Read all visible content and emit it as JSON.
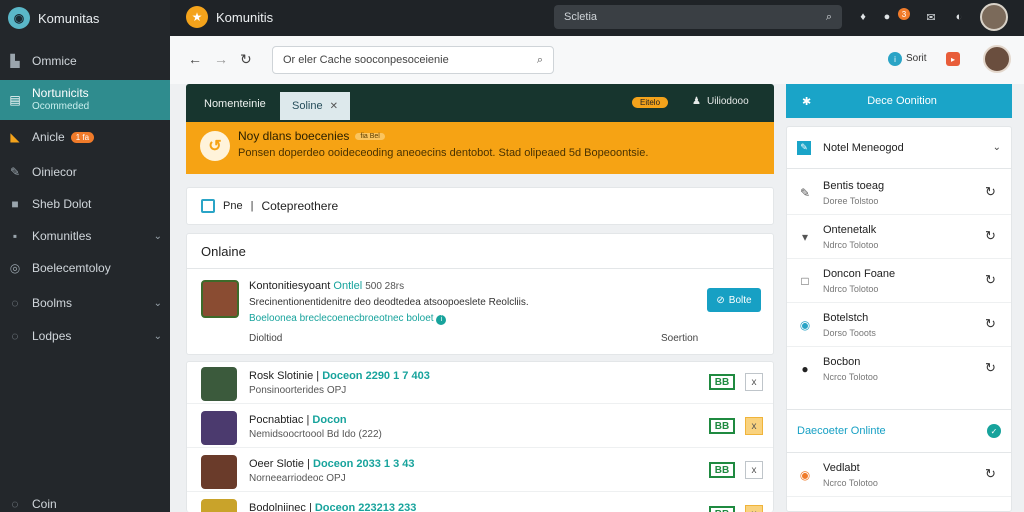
{
  "app": {
    "title": "Komunitas"
  },
  "sidebar": {
    "items": [
      {
        "label": "Ommice",
        "icon": "home-icon"
      },
      {
        "label": "Nortunicits",
        "sub": "Ocommeded",
        "icon": "grid-icon"
      },
      {
        "label": "Anicle",
        "badge": "1 fa",
        "icon": "folder-icon"
      },
      {
        "label": "Oiniecor",
        "icon": "tool-icon"
      },
      {
        "label": "Sheb Dolot",
        "icon": "square-icon"
      },
      {
        "label": "Komunitles",
        "icon": "tag-icon"
      },
      {
        "label": "Boelecemtoloy",
        "icon": "circle-icon"
      },
      {
        "label": "Boolms",
        "icon": "settings-icon"
      },
      {
        "label": "Lodpes",
        "icon": "info-icon"
      }
    ],
    "footer_label": "Coin"
  },
  "topbar": {
    "title": "Komunitis",
    "search_placeholder": "Scletia",
    "notif_count": "3"
  },
  "browser": {
    "url_placeholder": "Or eler Cache sooconpesoceienie",
    "right_label": "Sorit"
  },
  "main": {
    "header_title": "Nomenteinie",
    "tab_label": "Soline",
    "pill_label": "Eitelo",
    "user_label": "Uiliodooo",
    "banner": {
      "title": "Noy dlans boecenies",
      "badge": "fia Bel",
      "text": "Ponsen doperdeo ooideceoding aneoecins dentobot. Stad olipeaed 5d Bopeoontsie."
    },
    "crumb": {
      "prefix": "Pne",
      "sep": "|",
      "page": "Cotepreothere"
    },
    "featured": {
      "section_title": "Onlaine",
      "name": "Kontonitiesyoant",
      "status": "Ontlel",
      "count": "500 28rs",
      "desc": "Srecinentionentidenitre deo deodtedea atsoopoeslete Reolcliis.",
      "link": "Boeloonea breclecoenecbroeotnec boloet",
      "action": "Bolte",
      "meta_left": "Dioltiod",
      "meta_right": "Soertion"
    },
    "rows": [
      {
        "name": "Rosk Slotinie",
        "sep": "|",
        "tag": "Doceon 2290 1 7 403",
        "sub": "Ponsinoorterides OPJ",
        "badge": "BB",
        "action": "x"
      },
      {
        "name": "Pocnabtiac",
        "sep": "|",
        "tag": "Docon",
        "sub": "Nemidsoocrtoool Bd Ido (222)",
        "badge": "BB",
        "action": "x"
      },
      {
        "name": "Oeer Slotie",
        "sep": "|",
        "tag": "Doceon 2033 1 3 43",
        "sub": "Norneearriodeoc OPJ",
        "badge": "BB",
        "action": "x"
      },
      {
        "name": "Bodolniinec",
        "sep": "|",
        "tag": "Doceon 223213 233",
        "sub": "",
        "badge": "BB",
        "action": "x"
      }
    ]
  },
  "right": {
    "cta_label": "Dece Oonition",
    "header": "Notel Meneogod",
    "items": [
      {
        "t1": "Bentis toeag",
        "t2": "Doree Tolstoo",
        "icon": "pin-icon"
      },
      {
        "t1": "Ontenetalk",
        "t2": "Ndrco Tolotoo",
        "icon": "comment-icon"
      },
      {
        "t1": "Doncon Foane",
        "t2": "Ndrco Tolotoo",
        "icon": "square-icon"
      },
      {
        "t1": "Botelstch",
        "t2": "Dorso Tooots",
        "icon": "globe-icon"
      },
      {
        "t1": "Bocbon",
        "t2": "Ncrco Tolotoo",
        "icon": "dot-icon"
      }
    ],
    "section_label": "Daecoeter Onlinte",
    "items2": [
      {
        "t1": "Vedlabt",
        "t2": "Ncrco Tolotoo",
        "icon": "target-icon"
      }
    ]
  }
}
